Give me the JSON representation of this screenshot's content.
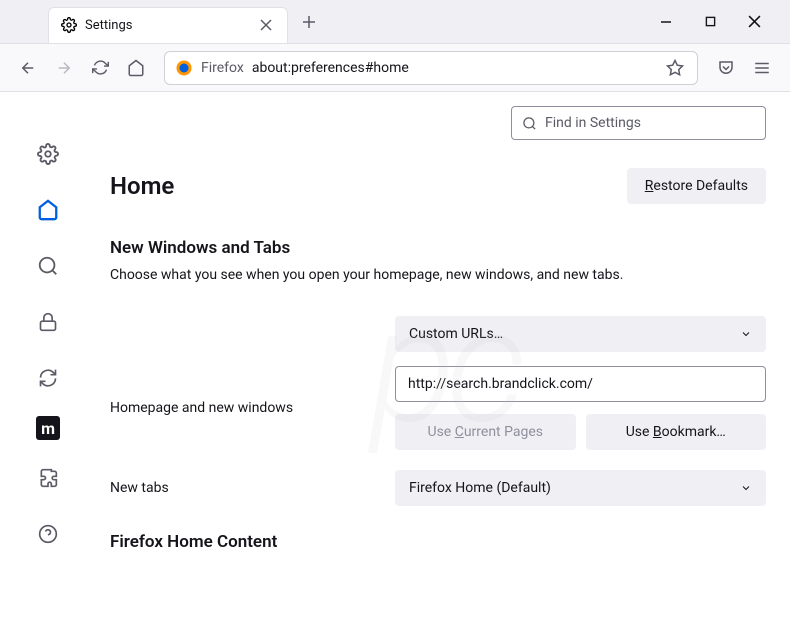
{
  "tab": {
    "title": "Settings"
  },
  "urlbar": {
    "prefix": "Firefox",
    "url": "about:preferences#home"
  },
  "search": {
    "placeholder": "Find in Settings"
  },
  "page": {
    "title": "Home",
    "restore": "estore Defaults",
    "restore_ul": "R"
  },
  "section1": {
    "title": "New Windows and Tabs",
    "desc": "Choose what you see when you open your homepage, new windows, and new tabs."
  },
  "homepage": {
    "label": "Homepage and new windows",
    "select": "Custom URLs…",
    "url": "http://search.brandclick.com/",
    "btn1_pre": "Use ",
    "btn1_ul": "C",
    "btn1_post": "urrent Pages",
    "btn2_pre": "Use ",
    "btn2_ul": "B",
    "btn2_post": "ookmark…"
  },
  "newtabs": {
    "label": "New tabs",
    "select": "Firefox Home (Default)"
  },
  "section2": {
    "title": "Firefox Home Content"
  }
}
